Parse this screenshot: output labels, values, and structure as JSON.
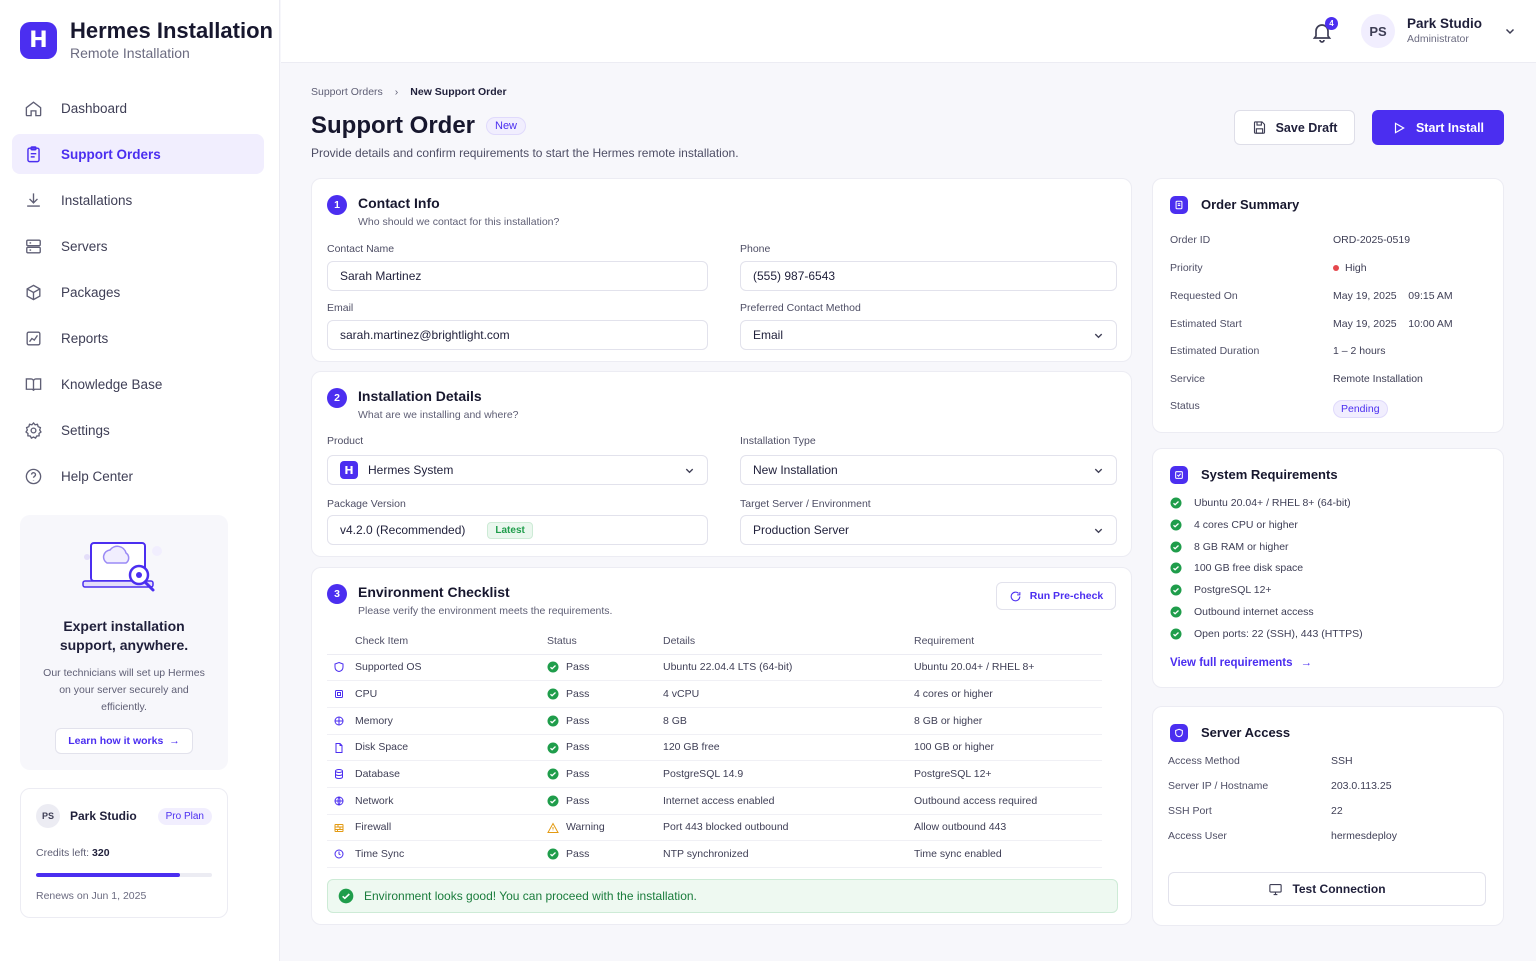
{
  "app": {
    "title": "Hermes Installation",
    "subtitle": "Remote Installation",
    "logo_letter": "H"
  },
  "sidebar": {
    "items": [
      {
        "label": "Dashboard",
        "icon": "home-icon",
        "active": false
      },
      {
        "label": "Support Orders",
        "icon": "clipboard-icon",
        "active": true
      },
      {
        "label": "Installations",
        "icon": "download-icon",
        "active": false
      },
      {
        "label": "Servers",
        "icon": "server-icon",
        "active": false
      },
      {
        "label": "Packages",
        "icon": "package-icon",
        "active": false
      },
      {
        "label": "Reports",
        "icon": "chart-icon",
        "active": false
      },
      {
        "label": "Knowledge Base",
        "icon": "book-icon",
        "active": false
      },
      {
        "label": "Settings",
        "icon": "gear-icon",
        "active": false
      },
      {
        "label": "Help Center",
        "icon": "help-icon",
        "active": false
      }
    ],
    "promo": {
      "title": "Expert installation support, anywhere.",
      "text": "Our technicians will set up Hermes on your server securely and efficiently.",
      "link": "Learn how it works"
    },
    "account": {
      "initials": "PS",
      "name": "Park Studio",
      "plan": "Pro Plan",
      "credits_label": "Credits left:",
      "credits_value": "320",
      "credits_fraction": 0.82,
      "renews": "Renews on Jun 1, 2025"
    }
  },
  "topbar": {
    "notification_count": "4",
    "user": {
      "initials": "PS",
      "name": "Park Studio",
      "role": "Administrator"
    }
  },
  "header": {
    "breadcrumb": [
      "Support Orders",
      "New Support Order"
    ],
    "title": "Support Order",
    "badge": "New",
    "subtitle": "Provide details and confirm requirements to start the Hermes remote installation.",
    "save_draft": "Save Draft",
    "start_install": "Start Install"
  },
  "contact": {
    "step": "1",
    "title": "Contact Info",
    "subtitle": "Who should we contact for this installation?",
    "name_label": "Contact Name",
    "name_value": "Sarah Martinez",
    "phone_label": "Phone",
    "phone_value": "(555) 987-6543",
    "email_label": "Email",
    "email_value": "sarah.martinez@brightlight.com",
    "method_label": "Preferred Contact Method",
    "method_value": "Email"
  },
  "install": {
    "step": "2",
    "title": "Installation Details",
    "subtitle": "What are we installing and where?",
    "product_label": "Product",
    "product_value": "Hermes System",
    "type_label": "Installation Type",
    "type_value": "New Installation",
    "version_label": "Package Version",
    "version_value": "v4.2.0 (Recommended)",
    "version_badge": "Latest",
    "target_label": "Target Server / Environment",
    "target_value": "Production Server"
  },
  "checklist": {
    "step": "3",
    "title": "Environment Checklist",
    "subtitle": "Please verify the environment meets the requirements.",
    "precheck_button": "Run Pre-check",
    "columns": [
      "Check Item",
      "Status",
      "Details",
      "Requirement"
    ],
    "rows": [
      {
        "item": "Supported OS",
        "icon": "shield-icon",
        "status": "Pass",
        "details": "Ubuntu 22.04.4 LTS (64-bit)",
        "requirement": "Ubuntu 20.04+ / RHEL 8+"
      },
      {
        "item": "CPU",
        "icon": "cpu-icon",
        "status": "Pass",
        "details": "4 vCPU",
        "requirement": "4 cores or higher"
      },
      {
        "item": "Memory",
        "icon": "memory-icon",
        "status": "Pass",
        "details": "8 GB",
        "requirement": "8 GB or higher"
      },
      {
        "item": "Disk Space",
        "icon": "disk-icon",
        "status": "Pass",
        "details": "120 GB free",
        "requirement": "100 GB or higher"
      },
      {
        "item": "Database",
        "icon": "database-icon",
        "status": "Pass",
        "details": "PostgreSQL 14.9",
        "requirement": "PostgreSQL 12+"
      },
      {
        "item": "Network",
        "icon": "globe-icon",
        "status": "Pass",
        "details": "Internet access enabled",
        "requirement": "Outbound access required"
      },
      {
        "item": "Firewall",
        "icon": "firewall-icon",
        "status": "Warning",
        "details": "Port 443 blocked outbound",
        "requirement": "Allow outbound 443"
      },
      {
        "item": "Time Sync",
        "icon": "clock-icon",
        "status": "Pass",
        "details": "NTP synchronized",
        "requirement": "Time sync enabled"
      }
    ],
    "banner": "Environment looks good! You can proceed with the installation."
  },
  "summary": {
    "title": "Order Summary",
    "rows": [
      {
        "k": "Order ID",
        "v": "ORD-2025-0519"
      },
      {
        "k": "Priority",
        "v": "High"
      },
      {
        "k": "Requested On",
        "v": "May 19, 2025    09:15 AM"
      },
      {
        "k": "Estimated Start",
        "v": "May 19, 2025    10:00 AM"
      },
      {
        "k": "Estimated Duration",
        "v": "1 – 2 hours"
      },
      {
        "k": "Service",
        "v": "Remote Installation"
      },
      {
        "k": "Status",
        "v": "Pending"
      }
    ]
  },
  "requirements": {
    "title": "System Requirements",
    "items": [
      "Ubuntu 20.04+ / RHEL 8+ (64-bit)",
      "4 cores CPU or higher",
      "8 GB RAM or higher",
      "100 GB free disk space",
      "PostgreSQL 12+",
      "Outbound internet access",
      "Open ports: 22 (SSH), 443 (HTTPS)"
    ],
    "link": "View full requirements"
  },
  "access": {
    "title": "Server Access",
    "rows": [
      {
        "k": "Access Method",
        "v": "SSH"
      },
      {
        "k": "Server IP / Hostname",
        "v": "203.0.113.25"
      },
      {
        "k": "SSH Port",
        "v": "22"
      },
      {
        "k": "Access User",
        "v": "hermesdeploy"
      }
    ],
    "test_button": "Test Connection"
  },
  "colors": {
    "accent": "#4b2ef0",
    "success": "#1f9d4b",
    "warning": "#e39a12",
    "danger": "#e5484d"
  }
}
